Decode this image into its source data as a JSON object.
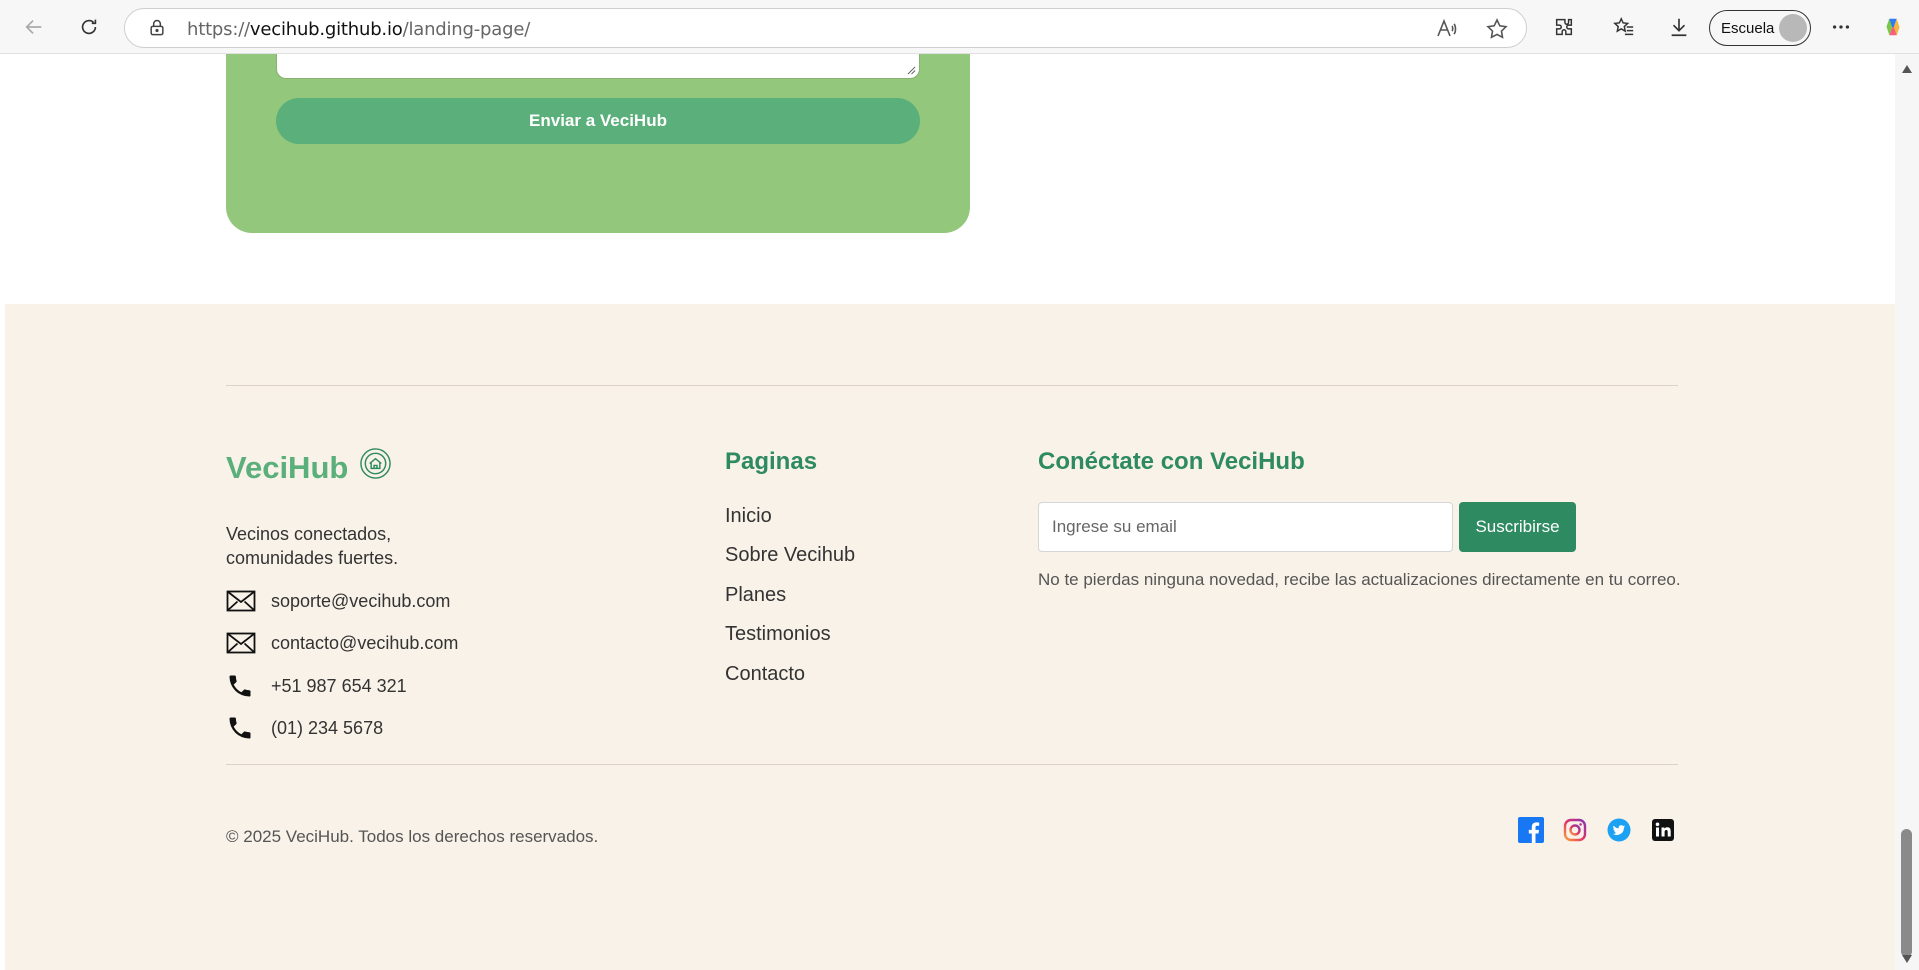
{
  "browser": {
    "url_prefix": "https://",
    "url_host": "vecihub.github.io",
    "url_path": "/landing-page/",
    "profile_label": "Escuela"
  },
  "form": {
    "submit_label": "Enviar a VeciHub"
  },
  "footer": {
    "brand": "VeciHub",
    "tagline_line1": "Vecinos conectados,",
    "tagline_line2": "comunidades fuertes.",
    "contacts": [
      {
        "icon": "envelope-icon",
        "text": "soporte@vecihub.com"
      },
      {
        "icon": "envelope-icon",
        "text": "contacto@vecihub.com"
      },
      {
        "icon": "phone-icon",
        "text": "+51 987 654 321"
      },
      {
        "icon": "phone-icon",
        "text": "(01) 234 5678"
      }
    ],
    "pages_title": "Paginas",
    "pages": [
      "Inicio",
      "Sobre Vecihub",
      "Planes",
      "Testimonios",
      "Contacto"
    ],
    "connect_title": "Conéctate con VeciHub",
    "email_placeholder": "Ingrese su email",
    "subscribe_label": "Suscribirse",
    "newsletter_note": "No te pierdas ninguna novedad, recibe las actualizaciones directamente en tu correo.",
    "copyright": "© 2025 VeciHub. Todos los derechos reservados.",
    "social": [
      "facebook-icon",
      "instagram-icon",
      "twitter-icon",
      "linkedin-icon"
    ]
  },
  "colors": {
    "brand_green": "#5aaf7a",
    "dark_green": "#2e8a60",
    "card_green": "#93c77b",
    "footer_bg": "#f9f2e8"
  }
}
